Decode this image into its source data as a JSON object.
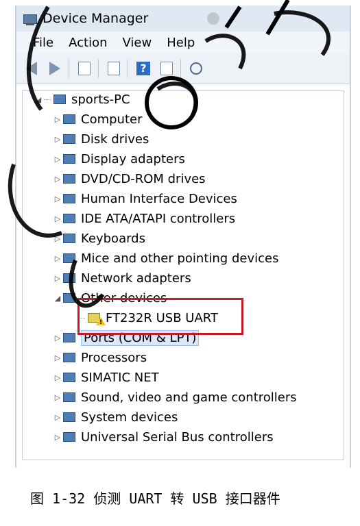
{
  "window": {
    "title": "Device Manager"
  },
  "menu": {
    "items": [
      "File",
      "Action",
      "View",
      "Help"
    ]
  },
  "tree": {
    "root": "sports-PC",
    "items": [
      {
        "label": "Computer",
        "icon": "computer-icon",
        "expander": "▷"
      },
      {
        "label": "Disk drives",
        "icon": "disk-drive-icon",
        "expander": "▷"
      },
      {
        "label": "Display adapters",
        "icon": "display-adapter-icon",
        "expander": "▷"
      },
      {
        "label": "DVD/CD-ROM drives",
        "icon": "dvd-drive-icon",
        "expander": "▷"
      },
      {
        "label": "Human Interface Devices",
        "icon": "hid-icon",
        "expander": "▷"
      },
      {
        "label": "IDE ATA/ATAPI controllers",
        "icon": "ide-controller-icon",
        "expander": "▷"
      },
      {
        "label": "Keyboards",
        "icon": "keyboard-icon",
        "expander": "▷"
      },
      {
        "label": "Mice and other pointing devices",
        "icon": "mouse-icon",
        "expander": "▷"
      },
      {
        "label": "Network adapters",
        "icon": "network-adapter-icon",
        "expander": "▷"
      },
      {
        "label": "Other devices",
        "icon": "other-devices-icon",
        "expander": "◢"
      },
      {
        "label": "FT232R USB UART",
        "icon": "warning-device-icon",
        "child": true
      },
      {
        "label": "Ports (COM & LPT)",
        "icon": "ports-icon",
        "expander": "▷",
        "selected": true
      },
      {
        "label": "Processors",
        "icon": "processor-icon",
        "expander": "▷"
      },
      {
        "label": "SIMATIC NET",
        "icon": "simatic-net-icon",
        "expander": "▷"
      },
      {
        "label": "Sound, video and game controllers",
        "icon": "sound-icon",
        "expander": "▷"
      },
      {
        "label": "System devices",
        "icon": "system-devices-icon",
        "expander": "▷"
      },
      {
        "label": "Universal Serial Bus controllers",
        "icon": "usb-icon",
        "expander": "▷"
      }
    ]
  },
  "caption": "图 1-32 侦测 UART 转 USB 接口器件"
}
